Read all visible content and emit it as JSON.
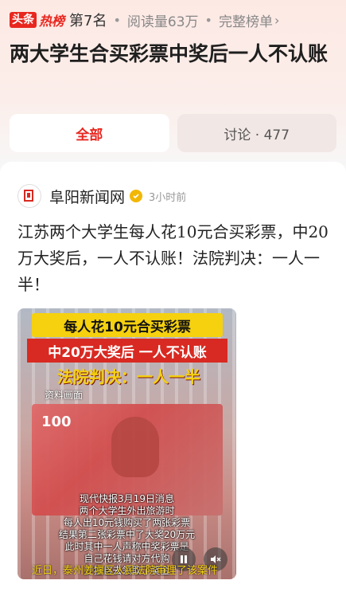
{
  "header": {
    "brand_toutiao": "头条",
    "brand_hot": "热榜",
    "rank": "第7名",
    "reads": "阅读量63万",
    "full_list": "完整榜单"
  },
  "headline": "两大学生合买彩票中奖后一人不认账",
  "tabs": [
    {
      "label": "全部",
      "active": true
    },
    {
      "label": "讨论 · 477",
      "active": false
    }
  ],
  "post": {
    "source_name": "阜阳新闻网",
    "time_ago": "3小时前",
    "body": "江苏两个大学生每人花10元合买彩票，中20万大奖后，一人不认账！法院判决：一人一半！"
  },
  "video": {
    "banner_1": "每人花10元合买彩票",
    "banner_2": "中20万大奖后 一人不认账",
    "banner_3": "法院判决：一人一半",
    "source_label": "资料画面",
    "bill_number": "100",
    "caption_lines": [
      "现代快报3月19日消息",
      "两个大学生外出旅游时",
      "每人出10元钱购买了两张彩票",
      "结果第二张彩票中了大奖20万元",
      "此时其中一人声称中奖彩票是",
      "自己花钱请对方代购",
      "并独自去领取了奖金"
    ],
    "bottom_text": "近日，泰州姜堰区人民法院审理了该案件"
  },
  "colors": {
    "accent": "#e8271f",
    "banner_yellow": "#f5d10f",
    "banner_red": "#d82a22"
  }
}
